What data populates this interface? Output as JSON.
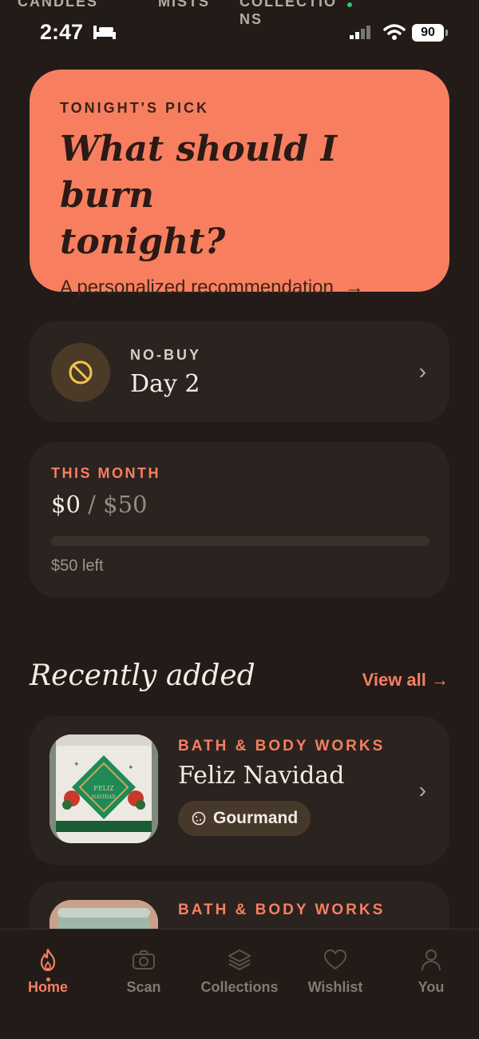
{
  "ghost_tabs": [
    "CANDLES",
    "MISTS",
    "COLLECTIO",
    "NS"
  ],
  "status": {
    "time": "2:47",
    "battery": "90"
  },
  "hero": {
    "kicker": "TONIGHT'S PICK",
    "title_line1": "What should I burn",
    "title_line2": "tonight?",
    "subtitle": "A personalized recommendation",
    "arrow": "→"
  },
  "nobuy": {
    "kicker": "NO-BUY",
    "day": "Day 2",
    "chevron": "›"
  },
  "month": {
    "kicker": "THIS MONTH",
    "spent": "$0",
    "slash": " / ",
    "budget": "$50",
    "progress_fraction": 0,
    "left": "$50 left"
  },
  "recent": {
    "title": "Recently added",
    "view_all": "View all →",
    "items": [
      {
        "brand": "BATH & BODY WORKS",
        "name": "Feliz Navidad",
        "tag": "Gourmand",
        "chevron": "›",
        "label_text_line1": "FELIZ",
        "label_text_line2": "NAVIDAD"
      },
      {
        "brand": "BATH & BODY WORKS"
      }
    ]
  },
  "nav": {
    "items": [
      {
        "label": "Home",
        "icon": "flame-icon",
        "active": true
      },
      {
        "label": "Scan",
        "icon": "camera-icon"
      },
      {
        "label": "Collections",
        "icon": "layers-icon"
      },
      {
        "label": "Wishlist",
        "icon": "heart-icon"
      },
      {
        "label": "You",
        "icon": "person-icon"
      }
    ]
  },
  "colors": {
    "background": "#221b18",
    "accent": "#f77f60",
    "card": "#2b2320"
  }
}
